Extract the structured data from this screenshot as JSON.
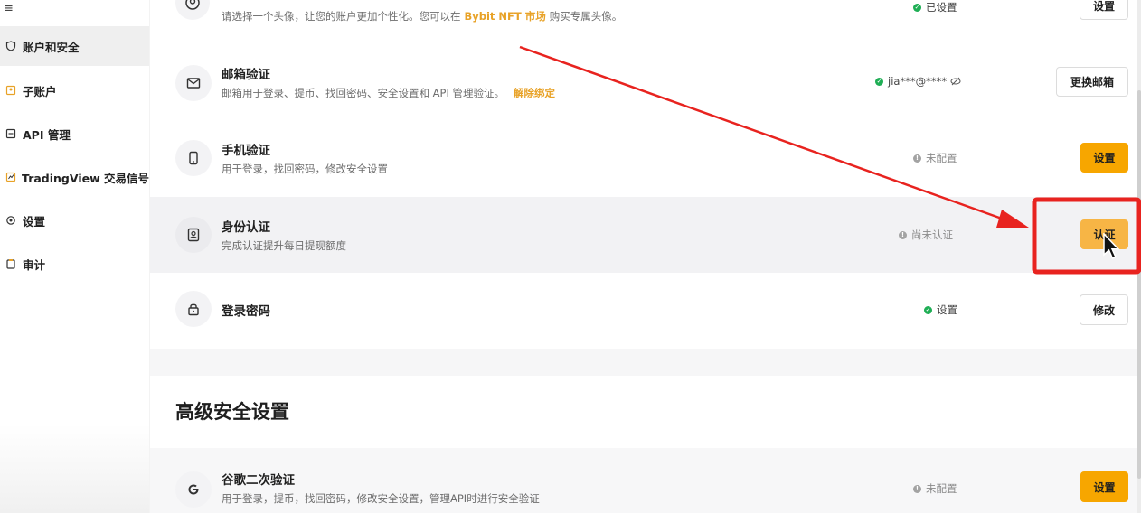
{
  "sidebar": {
    "menu_glyph": "≡",
    "items": [
      {
        "label": "账户和安全",
        "icon": "shield-icon",
        "active": true
      },
      {
        "label": "子账户",
        "icon": "sub-account-icon",
        "active": false
      },
      {
        "label": "API 管理",
        "icon": "api-icon",
        "active": false
      },
      {
        "label": "TradingView 交易信号",
        "icon": "tradingview-icon",
        "active": false
      },
      {
        "label": "设置",
        "icon": "gear-icon",
        "active": false
      },
      {
        "label": "审计",
        "icon": "clipboard-icon",
        "active": false
      }
    ]
  },
  "rows": {
    "avatar": {
      "desc": "请选择一个头像，让您的账户更加个性化。您可以在",
      "desc_link": "Bybit NFT 市场",
      "desc_suffix": "购买专属头像。",
      "status": "已设置",
      "button": "设置",
      "icon": "avatar-icon"
    },
    "email": {
      "title": "邮箱验证",
      "desc": "邮箱用于登录、提币、找回密码、安全设置和 API 管理验证。",
      "desc_link": "解除绑定",
      "status": "jia***@****",
      "status_icon": "eye-off-icon",
      "button": "更换邮箱",
      "icon": "mail-icon"
    },
    "phone": {
      "title": "手机验证",
      "desc": "用于登录，找回密码，修改安全设置",
      "status": "未配置",
      "button": "设置",
      "icon": "phone-icon"
    },
    "identity": {
      "title": "身份认证",
      "desc": "完成认证提升每日提现额度",
      "status": "尚未认证",
      "button": "认证",
      "icon": "id-card-icon"
    },
    "password": {
      "title": "登录密码",
      "status": "设置",
      "button": "修改",
      "icon": "lock-icon"
    },
    "google": {
      "title": "谷歌二次验证",
      "desc": "用于登录，提币，找回密码，修改安全设置，管理API时进行安全验证",
      "status": "未配置",
      "button": "设置",
      "icon": "google-icon"
    }
  },
  "advanced_section_title": "高级安全设置",
  "colors": {
    "accent": "#f7a600",
    "link": "#e8a227",
    "ok": "#1fae55",
    "annotation": "#e8231f"
  }
}
